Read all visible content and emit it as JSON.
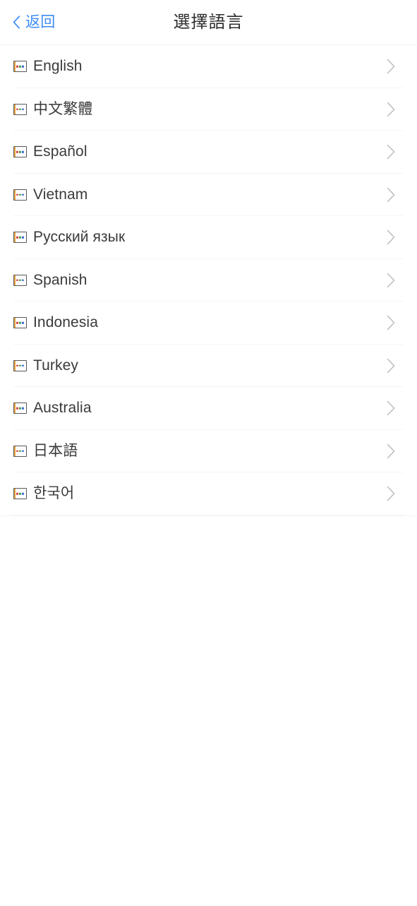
{
  "header": {
    "back_label": "返回",
    "back_icon": "chevron-left-icon",
    "title": "選擇語言",
    "accent_color": "#3c8cf8",
    "title_color": "#2b2b2b"
  },
  "list": {
    "row_icon": "broken-image-placeholder-icon",
    "row_accessory_icon": "chevron-right-icon",
    "divider_color": "#f4f5f6",
    "items": [
      {
        "label": "English"
      },
      {
        "label": "中文繁體"
      },
      {
        "label": "Español"
      },
      {
        "label": "Vietnam"
      },
      {
        "label": "Русский язык"
      },
      {
        "label": "Spanish"
      },
      {
        "label": "Indonesia"
      },
      {
        "label": "Turkey"
      },
      {
        "label": "Australia"
      },
      {
        "label": "日本語"
      },
      {
        "label": "한국어"
      }
    ]
  }
}
